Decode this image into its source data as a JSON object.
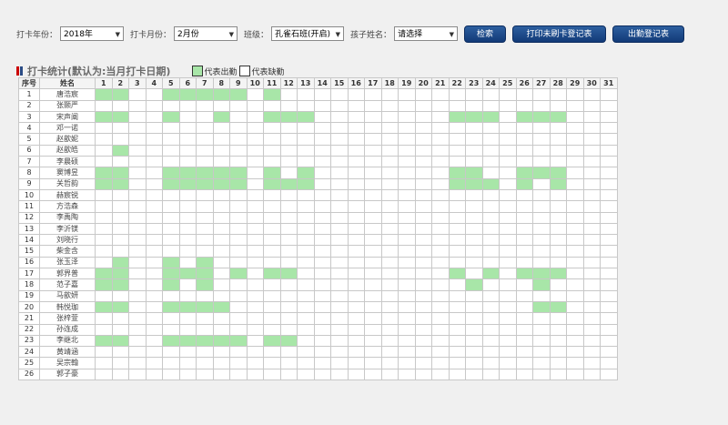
{
  "filters": {
    "year_label": "打卡年份：",
    "year_value": "2018年",
    "month_label": "打卡月份：",
    "month_value": "2月份",
    "class_label": "班级：",
    "class_value": "孔雀石班(开启)",
    "child_label": "孩子姓名：",
    "child_value": "请选择"
  },
  "buttons": {
    "search": "检索",
    "print_unpunched": "打印未刷卡登记表",
    "attendance_register": "出勤登记表"
  },
  "section": {
    "title": "打卡统计(默认为:当月打卡日期)",
    "legend_present": "代表出勤",
    "legend_absent": "代表缺勤",
    "present_color": "#a8e6a8"
  },
  "table": {
    "col_index": "序号",
    "col_name": "姓名",
    "days": [
      "1",
      "2",
      "3",
      "4",
      "5",
      "6",
      "7",
      "8",
      "9",
      "10",
      "11",
      "12",
      "13",
      "14",
      "15",
      "16",
      "17",
      "18",
      "19",
      "20",
      "21",
      "22",
      "23",
      "24",
      "25",
      "26",
      "27",
      "28",
      "29",
      "30",
      "31"
    ],
    "rows": [
      {
        "no": "1",
        "name": "唐浩宸",
        "present": [
          1,
          2,
          5,
          6,
          7,
          8,
          9,
          11
        ]
      },
      {
        "no": "2",
        "name": "张颢严",
        "present": []
      },
      {
        "no": "3",
        "name": "宋声阐",
        "present": [
          1,
          2,
          5,
          8,
          11,
          12,
          13,
          22,
          23,
          24,
          26,
          27,
          28
        ]
      },
      {
        "no": "4",
        "name": "邓一诺",
        "present": []
      },
      {
        "no": "5",
        "name": "赵歆妮",
        "present": []
      },
      {
        "no": "6",
        "name": "赵歆皓",
        "present": [
          2
        ]
      },
      {
        "no": "7",
        "name": "李晨硕",
        "present": []
      },
      {
        "no": "8",
        "name": "窦博昱",
        "present": [
          1,
          2,
          5,
          6,
          7,
          8,
          9,
          11,
          13,
          22,
          23,
          26,
          27,
          28
        ]
      },
      {
        "no": "9",
        "name": "关哲韵",
        "present": [
          1,
          2,
          5,
          6,
          7,
          8,
          9,
          11,
          12,
          13,
          22,
          23,
          24,
          26,
          28
        ]
      },
      {
        "no": "10",
        "name": "赫宸锐",
        "present": []
      },
      {
        "no": "11",
        "name": "方浩森",
        "present": []
      },
      {
        "no": "12",
        "name": "李禹陶",
        "present": []
      },
      {
        "no": "13",
        "name": "李沂镁",
        "present": []
      },
      {
        "no": "14",
        "name": "刘晓行",
        "present": []
      },
      {
        "no": "15",
        "name": "柴金含",
        "present": []
      },
      {
        "no": "16",
        "name": "张玉泽",
        "present": [
          2,
          5,
          7
        ]
      },
      {
        "no": "17",
        "name": "郭界普",
        "present": [
          1,
          2,
          5,
          6,
          7,
          9,
          11,
          12,
          22,
          24,
          26,
          27,
          28
        ]
      },
      {
        "no": "18",
        "name": "范子嘉",
        "present": [
          1,
          2,
          5,
          7,
          23,
          27
        ]
      },
      {
        "no": "19",
        "name": "马歆妍",
        "present": []
      },
      {
        "no": "20",
        "name": "韩悦珈",
        "present": [
          1,
          2,
          5,
          6,
          7,
          8,
          27,
          28
        ]
      },
      {
        "no": "21",
        "name": "张梓萱",
        "present": []
      },
      {
        "no": "22",
        "name": "孙连成",
        "present": []
      },
      {
        "no": "23",
        "name": "李继北",
        "present": [
          1,
          2,
          5,
          6,
          7,
          8,
          9,
          11,
          12
        ]
      },
      {
        "no": "24",
        "name": "黄靖涵",
        "present": []
      },
      {
        "no": "25",
        "name": "吴宗翰",
        "present": []
      },
      {
        "no": "26",
        "name": "郭子豪",
        "present": []
      }
    ]
  }
}
